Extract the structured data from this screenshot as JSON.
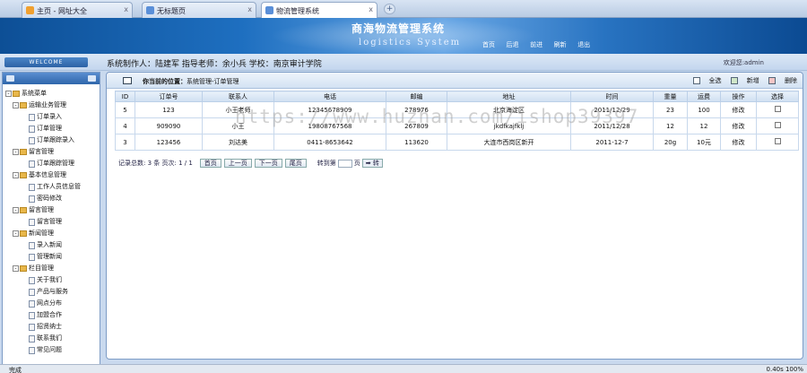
{
  "browser": {
    "tabs": [
      {
        "label": "主页 - 网址大全",
        "active": false
      },
      {
        "label": "无标题页",
        "active": false
      },
      {
        "label": "物流管理系统",
        "active": true
      }
    ],
    "new_tab": "+",
    "close": "x"
  },
  "header": {
    "title": "商海物流管理系统",
    "subtitle": "logistics System",
    "nav": [
      "首页",
      "后退",
      "前进",
      "刷新",
      "退出"
    ]
  },
  "infobar": {
    "welcome": "WELCOME",
    "author": "系统制作人：陆建军 指导老师：余小兵 学校：南京审计学院",
    "user": "欢迎您:admin"
  },
  "sidebar": {
    "tree": [
      {
        "label": "系统菜单",
        "level": 0,
        "icon": "folder-icon"
      },
      {
        "label": "运输业务管理",
        "level": 1,
        "icon": "folder-icon"
      },
      {
        "label": "订单录入",
        "level": 2,
        "icon": "page-icon"
      },
      {
        "label": "订单管理",
        "level": 2,
        "icon": "page-icon"
      },
      {
        "label": "订单跟踪录入",
        "level": 2,
        "icon": "page-icon"
      },
      {
        "label": "留言管理",
        "level": 1,
        "icon": "folder-icon"
      },
      {
        "label": "订单跟踪管理",
        "level": 2,
        "icon": "page-icon"
      },
      {
        "label": "基本信息管理",
        "level": 1,
        "icon": "folder-icon"
      },
      {
        "label": "工作人员信息管",
        "level": 2,
        "icon": "page-icon"
      },
      {
        "label": "密码修改",
        "level": 2,
        "icon": "page-icon"
      },
      {
        "label": "留言管理",
        "level": 1,
        "icon": "folder-icon"
      },
      {
        "label": "留言管理",
        "level": 2,
        "icon": "page-icon"
      },
      {
        "label": "新闻管理",
        "level": 1,
        "icon": "folder-icon"
      },
      {
        "label": "录入新闻",
        "level": 2,
        "icon": "page-icon"
      },
      {
        "label": "管理新闻",
        "level": 2,
        "icon": "page-icon"
      },
      {
        "label": "栏目管理",
        "level": 1,
        "icon": "folder-icon"
      },
      {
        "label": "关于我们",
        "level": 2,
        "icon": "page-icon"
      },
      {
        "label": "产品与服务",
        "level": 2,
        "icon": "page-icon"
      },
      {
        "label": "网点分布",
        "level": 2,
        "icon": "page-icon"
      },
      {
        "label": "加盟合作",
        "level": 2,
        "icon": "page-icon"
      },
      {
        "label": "招贤纳士",
        "level": 2,
        "icon": "page-icon"
      },
      {
        "label": "联系我们",
        "level": 2,
        "icon": "page-icon"
      },
      {
        "label": "常见问题",
        "level": 2,
        "icon": "page-icon"
      }
    ]
  },
  "main": {
    "location_label": "你当前的位置：",
    "location": "系统管理-订单管理",
    "tools": {
      "select_all": "全选",
      "add": "新增",
      "delete": "删除"
    },
    "columns": [
      "ID",
      "订单号",
      "联系人",
      "电话",
      "邮编",
      "地址",
      "时间",
      "重量",
      "运费",
      "操作",
      "选择"
    ],
    "rows": [
      [
        "5",
        "123",
        "小王老师",
        "12345678909",
        "278976",
        "北京海淀区",
        "2011/12/29",
        "23",
        "100",
        "修改"
      ],
      [
        "4",
        "909090",
        "小王",
        "19808767568",
        "267809",
        "jkdfkajfklj",
        "2011/12/28",
        "12",
        "12",
        "修改"
      ],
      [
        "3",
        "123456",
        "刘达美",
        "0411-8653642",
        "113620",
        "大连市西岗区新开",
        "2011-12-7",
        "20g",
        "10元",
        "修改"
      ]
    ],
    "pager": {
      "summary": "记录总数: 3 条  页次: 1 / 1",
      "first": "首页",
      "prev": "上一页",
      "next": "下一页",
      "last": "尾页",
      "goto": "转到第",
      "page_unit": "页",
      "go": "➡ 转"
    }
  },
  "statusbar": {
    "left": "完成",
    "right": "0.40s   100%"
  },
  "watermark": "https://www.huzhan.com/ishop39397"
}
